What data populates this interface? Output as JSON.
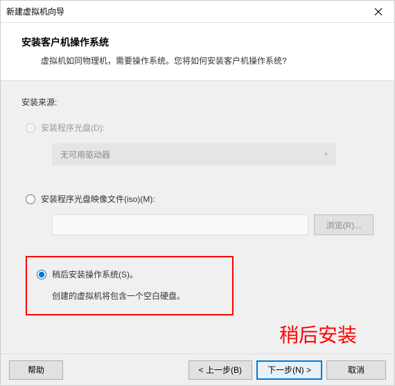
{
  "window": {
    "title": "新建虚拟机向导"
  },
  "header": {
    "title": "安装客户机操作系统",
    "description": "虚拟机如同物理机，需要操作系统。您将如何安装客户机操作系统?"
  },
  "content": {
    "source_label": "安装来源:",
    "option_disc": "安装程序光盘(D):",
    "disc_select": "无可用驱动器",
    "option_iso": "安装程序光盘映像文件(iso)(M):",
    "iso_path": "",
    "browse_label": "浏览(R)...",
    "option_later": "稍后安装操作系统(S)。",
    "later_description": "创建的虚拟机将包含一个空白硬盘。"
  },
  "annotation": "稍后安装",
  "footer": {
    "help": "帮助",
    "back": "< 上一步(B)",
    "next": "下一步(N) >",
    "cancel": "取消"
  }
}
